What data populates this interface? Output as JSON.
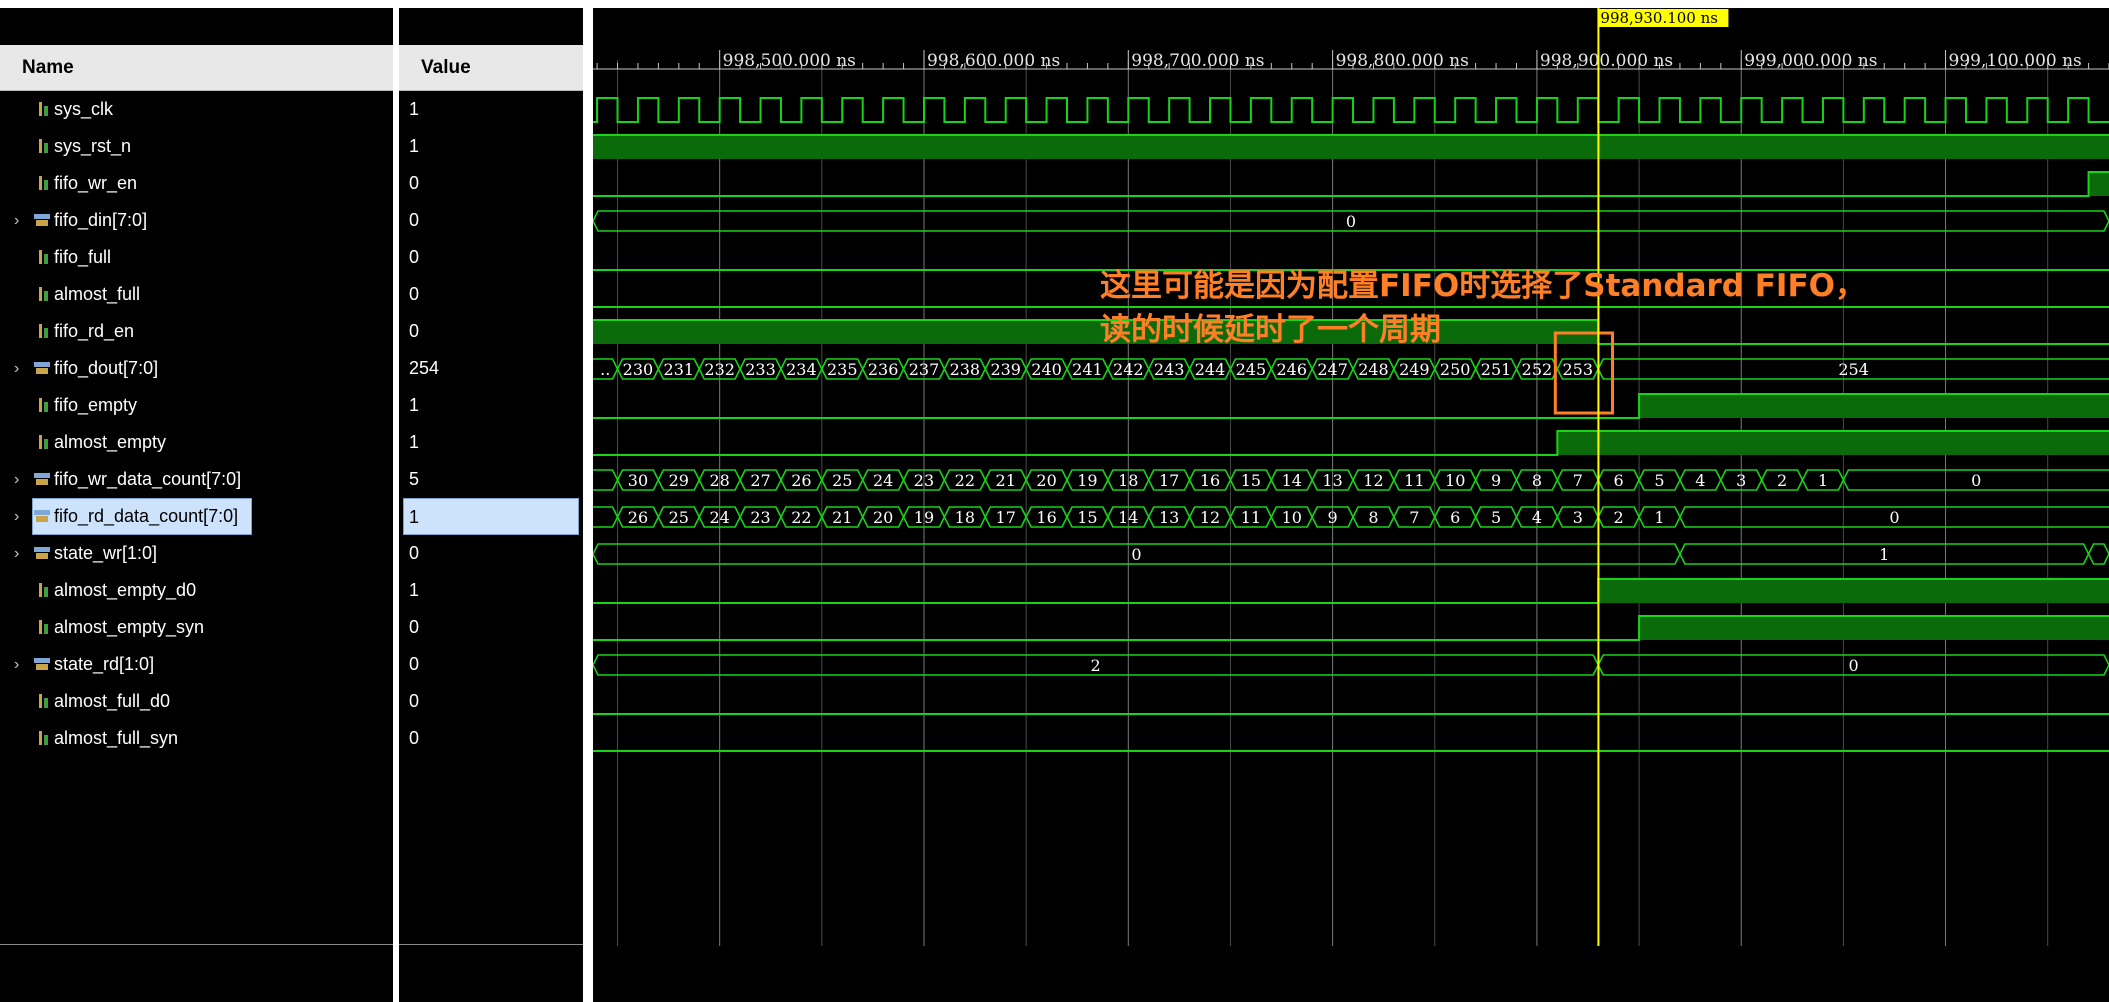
{
  "columns": {
    "name": "Name",
    "value": "Value"
  },
  "signals": [
    {
      "name": "sys_clk",
      "value": "1",
      "kind": "bit",
      "expandable": false
    },
    {
      "name": "sys_rst_n",
      "value": "1",
      "kind": "bit",
      "expandable": false
    },
    {
      "name": "fifo_wr_en",
      "value": "0",
      "kind": "bit",
      "expandable": false
    },
    {
      "name": "fifo_din[7:0]",
      "value": "0",
      "kind": "bus",
      "expandable": true
    },
    {
      "name": "fifo_full",
      "value": "0",
      "kind": "bit",
      "expandable": false
    },
    {
      "name": "almost_full",
      "value": "0",
      "kind": "bit",
      "expandable": false
    },
    {
      "name": "fifo_rd_en",
      "value": "0",
      "kind": "bit",
      "expandable": false
    },
    {
      "name": "fifo_dout[7:0]",
      "value": "254",
      "kind": "bus",
      "expandable": true
    },
    {
      "name": "fifo_empty",
      "value": "1",
      "kind": "bit",
      "expandable": false
    },
    {
      "name": "almost_empty",
      "value": "1",
      "kind": "bit",
      "expandable": false
    },
    {
      "name": "fifo_wr_data_count[7:0]",
      "value": "5",
      "kind": "bus",
      "expandable": true
    },
    {
      "name": "fifo_rd_data_count[7:0]",
      "value": "1",
      "kind": "bus",
      "expandable": true,
      "selected": true
    },
    {
      "name": "state_wr[1:0]",
      "value": "0",
      "kind": "bus",
      "expandable": true
    },
    {
      "name": "almost_empty_d0",
      "value": "1",
      "kind": "bit",
      "expandable": false
    },
    {
      "name": "almost_empty_syn",
      "value": "0",
      "kind": "bit",
      "expandable": false
    },
    {
      "name": "state_rd[1:0]",
      "value": "0",
      "kind": "bus",
      "expandable": true
    },
    {
      "name": "almost_full_d0",
      "value": "0",
      "kind": "bit",
      "expandable": false
    },
    {
      "name": "almost_full_syn",
      "value": "0",
      "kind": "bit",
      "expandable": false
    }
  ],
  "timeline": {
    "unit": "ns",
    "view_start": 998438,
    "view_end": 999180,
    "ticks": [
      {
        "t": 998500,
        "label": "998,500.000 ns"
      },
      {
        "t": 998600,
        "label": "998,600.000 ns"
      },
      {
        "t": 998700,
        "label": "998,700.000 ns"
      },
      {
        "t": 998800,
        "label": "998,800.000 ns"
      },
      {
        "t": 998900,
        "label": "998,900.000 ns"
      },
      {
        "t": 999000,
        "label": "999,000.000 ns"
      },
      {
        "t": 999100,
        "label": "999,100.000 ns"
      }
    ],
    "cursor": {
      "t": 998930.1,
      "label": "998,930.100 ns",
      "color": "#ffff00"
    }
  },
  "waves": {
    "sys_clk": {
      "type": "clock",
      "period": 20,
      "first_rise": 998440
    },
    "sys_rst_n": {
      "type": "bit",
      "init": 1,
      "transitions": []
    },
    "fifo_wr_en": {
      "type": "bit",
      "init": 0,
      "transitions": [
        999170
      ]
    },
    "fifo_din": {
      "type": "bus",
      "segments": [
        {
          "t0": 998438,
          "t1": 999180,
          "label": "0"
        }
      ]
    },
    "fifo_full": {
      "type": "bit",
      "init": 0,
      "transitions": []
    },
    "almost_full": {
      "type": "bit",
      "init": 0,
      "transitions": []
    },
    "fifo_rd_en": {
      "type": "bit",
      "init": 1,
      "transitions": [
        998930
      ]
    },
    "fifo_dout": {
      "type": "bus",
      "first_label": "..",
      "first_end": 998450,
      "step": 20,
      "labels": [
        "230",
        "231",
        "232",
        "233",
        "234",
        "235",
        "236",
        "237",
        "238",
        "239",
        "240",
        "241",
        "242",
        "243",
        "244",
        "245",
        "246",
        "247",
        "248",
        "249",
        "250",
        "251",
        "252",
        "253"
      ],
      "last_label": "254"
    },
    "fifo_empty": {
      "type": "bit",
      "init": 0,
      "transitions": [
        998950
      ]
    },
    "almost_empty": {
      "type": "bit",
      "init": 0,
      "transitions": [
        998910
      ]
    },
    "fifo_wr_data_count": {
      "type": "bus",
      "first_end": 998450,
      "step": 20,
      "labels": [
        "30",
        "29",
        "28",
        "27",
        "26",
        "25",
        "24",
        "23",
        "22",
        "21",
        "20",
        "19",
        "18",
        "17",
        "16",
        "15",
        "14",
        "13",
        "12",
        "11",
        "10",
        "9",
        "8",
        "7",
        "6",
        "5",
        "4",
        "3",
        "2",
        "1"
      ],
      "last_label": "0"
    },
    "fifo_rd_data_count": {
      "type": "bus",
      "first_end": 998450,
      "step": 20,
      "labels": [
        "26",
        "25",
        "24",
        "23",
        "22",
        "21",
        "20",
        "19",
        "18",
        "17",
        "16",
        "15",
        "14",
        "13",
        "12",
        "11",
        "10",
        "9",
        "8",
        "7",
        "6",
        "5",
        "4",
        "3",
        "2",
        "1"
      ],
      "last_label": "0"
    },
    "state_wr": {
      "type": "bus",
      "segments": [
        {
          "t0": 998438,
          "t1": 998970,
          "label": "0"
        },
        {
          "t0": 998970,
          "t1": 999170,
          "label": "1"
        },
        {
          "t0": 999170,
          "t1": 999180,
          "label": ""
        }
      ]
    },
    "almost_empty_d0": {
      "type": "bit",
      "init": 0,
      "transitions": [
        998930
      ]
    },
    "almost_empty_syn": {
      "type": "bit",
      "init": 0,
      "transitions": [
        998950
      ]
    },
    "state_rd": {
      "type": "bus",
      "segments": [
        {
          "t0": 998438,
          "t1": 998930,
          "label": "2"
        },
        {
          "t0": 998930,
          "t1": 999180,
          "label": "0"
        }
      ]
    },
    "almost_full_d0": {
      "type": "bit",
      "init": 0,
      "transitions": []
    },
    "almost_full_syn": {
      "type": "bit",
      "init": 0,
      "transitions": []
    }
  },
  "annotation": {
    "line1": "这里可能是因为配置FIFO时选择了Standard FIFO，",
    "line2": "读的时候延时了一个周期",
    "color": "#ff7f27",
    "box_t0": 998909,
    "box_t1": 998937
  },
  "colors": {
    "wave": "#17d417",
    "wave_fill": "#0b6b0b",
    "grid": "#7a7a7a",
    "cursor": "#ffff00",
    "selected_row": "#cde3fb"
  },
  "icons": {
    "bit": "bit-signal-icon",
    "bus": "bus-signal-icon"
  }
}
